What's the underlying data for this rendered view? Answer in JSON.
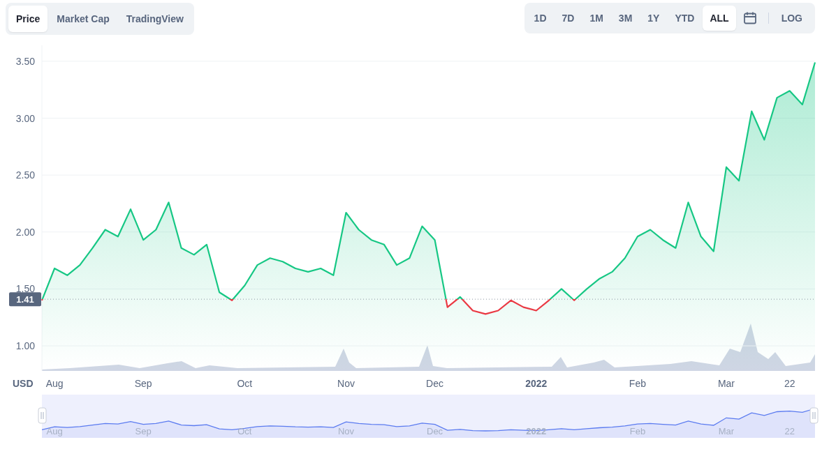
{
  "view_tabs": [
    {
      "label": "Price",
      "selected": true
    },
    {
      "label": "Market Cap",
      "selected": false
    },
    {
      "label": "TradingView",
      "selected": false
    }
  ],
  "ranges": [
    {
      "label": "1D",
      "selected": false
    },
    {
      "label": "7D",
      "selected": false
    },
    {
      "label": "1M",
      "selected": false
    },
    {
      "label": "3M",
      "selected": false
    },
    {
      "label": "1Y",
      "selected": false
    },
    {
      "label": "YTD",
      "selected": false
    },
    {
      "label": "ALL",
      "selected": true
    }
  ],
  "log_toggle": {
    "label": "LOG",
    "selected": false
  },
  "chart": {
    "chart_data": {
      "type": "area",
      "ylabel": "USD",
      "ylim": [
        0.78,
        3.64
      ],
      "yticks": [
        {
          "value": 1,
          "label": "1.00"
        },
        {
          "value": 1.5,
          "label": "1.50"
        },
        {
          "value": 2,
          "label": "2.00"
        },
        {
          "value": 2.5,
          "label": "2.50"
        },
        {
          "value": 3,
          "label": "3.00"
        },
        {
          "value": 3.5,
          "label": "3.50"
        }
      ],
      "categories": [
        null,
        "Aug",
        null,
        null,
        null,
        null,
        null,
        null,
        "Sep",
        null,
        null,
        null,
        null,
        null,
        null,
        null,
        "Oct",
        null,
        null,
        null,
        null,
        null,
        null,
        null,
        "Nov",
        null,
        null,
        null,
        null,
        null,
        null,
        "Dec",
        null,
        null,
        null,
        null,
        null,
        null,
        null,
        "2022",
        null,
        null,
        null,
        null,
        null,
        null,
        null,
        "Feb",
        null,
        null,
        null,
        null,
        null,
        null,
        "Mar",
        null,
        null,
        null,
        null,
        "22",
        null,
        null
      ],
      "series": [
        {
          "color": "#16c784",
          "values": [
            1.4,
            1.68,
            1.62,
            1.71,
            1.86,
            2.02,
            1.96,
            2.2,
            1.93,
            2.02,
            2.26,
            1.86,
            1.8,
            1.89,
            1.47,
            1.4,
            1.53,
            1.71,
            1.77,
            1.74,
            1.68,
            1.65,
            1.68,
            1.62,
            2.17,
            2.02,
            1.93,
            1.89,
            1.71,
            1.77,
            2.05,
            1.93,
            1.34,
            1.43,
            1.31,
            1.28,
            1.31,
            1.4,
            1.34,
            1.31,
            1.4,
            1.5,
            1.4,
            1.5,
            1.59,
            1.65,
            1.77,
            1.96,
            2.02,
            1.93,
            1.86,
            2.26,
            1.96,
            1.83,
            2.57,
            2.45,
            3.06,
            2.81,
            3.18,
            3.24,
            3.12,
            3.49
          ]
        }
      ],
      "ref_lines": [
        {
          "axis": "y",
          "value": 1.41,
          "label": "1.41"
        }
      ],
      "grid": true
    }
  },
  "navigator": {
    "labels": [
      "Aug",
      "Sep",
      "Oct",
      "Nov",
      "Dec",
      "2022",
      "Feb",
      "Mar",
      "22"
    ]
  }
}
